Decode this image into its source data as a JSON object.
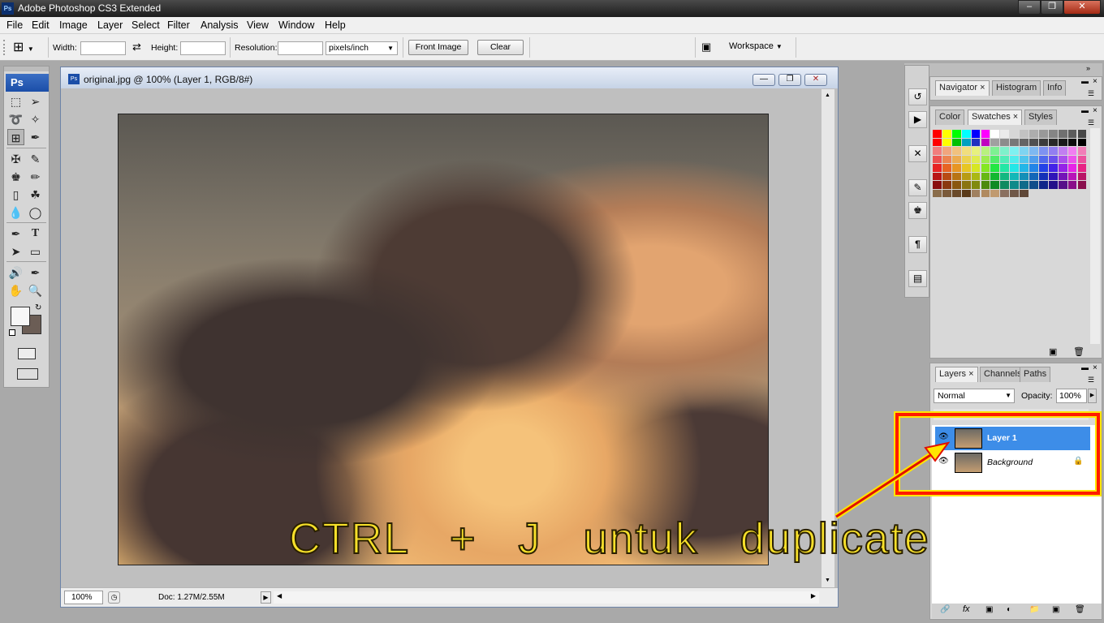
{
  "window": {
    "app_icon_text": "Ps",
    "title": "Adobe Photoshop CS3 Extended"
  },
  "menu": [
    "File",
    "Edit",
    "Image",
    "Layer",
    "Select",
    "Filter",
    "Analysis",
    "View",
    "Window",
    "Help"
  ],
  "options": {
    "width_label": "Width:",
    "height_label": "Height:",
    "resolution_label": "Resolution:",
    "units_value": "pixels/inch",
    "front_image_label": "Front Image",
    "clear_label": "Clear",
    "workspace_label": "Workspace"
  },
  "toolbox": {
    "logo": "Ps"
  },
  "document": {
    "title": "original.jpg @ 100% (Layer 1, RGB/8#)",
    "zoom": "100%",
    "doc_info": "Doc: 1.27M/2.55M"
  },
  "panels": {
    "top_tabs": [
      "Navigator",
      "Histogram",
      "Info"
    ],
    "mid_tabs": [
      "Color",
      "Swatches",
      "Styles"
    ],
    "layer_tabs": [
      "Layers",
      "Channels",
      "Paths"
    ],
    "blend_mode": "Normal",
    "opacity_label": "Opacity:",
    "opacity_value": "100%",
    "layers": [
      {
        "name": "Layer 1",
        "selected": true
      },
      {
        "name": "Background",
        "selected": false,
        "locked": true
      }
    ]
  },
  "annotation": {
    "text": "CTRL   +   J   untuk   duplicate"
  },
  "colors": {
    "selection": "#3d8de8",
    "annotation_text": "#f7e02a",
    "highlight_box": "#ff0000"
  }
}
